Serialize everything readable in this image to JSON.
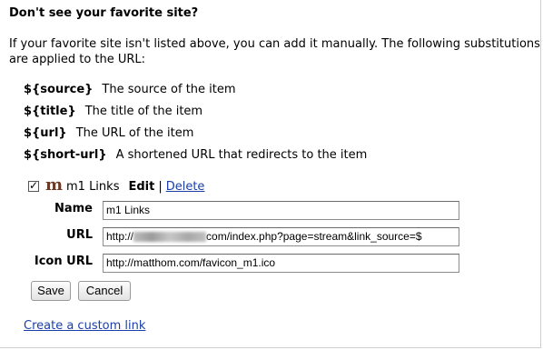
{
  "heading": "Don't see your favorite site?",
  "intro": "If your favorite site isn't listed above, you can add it manually. The following substitutions are applied to the URL:",
  "substitutions": [
    {
      "key": "${source}",
      "desc": "The source of the item"
    },
    {
      "key": "${title}",
      "desc": "The title of the item"
    },
    {
      "key": "${url}",
      "desc": "The URL of the item"
    },
    {
      "key": "${short-url}",
      "desc": "A shortened URL that redirects to the item"
    }
  ],
  "item": {
    "checked": true,
    "checkbox_glyph": "✓",
    "favicon_glyph": "m",
    "name": "m1 Links",
    "edit_label": "Edit",
    "separator": "|",
    "delete_label": "Delete"
  },
  "form": {
    "name_label": "Name",
    "name_value": "m1 Links",
    "url_label": "URL",
    "url_prefix": "http://",
    "url_suffix": "com/index.php?page=stream&link_source=$",
    "icon_label": "Icon URL",
    "icon_value": "http://matthom.com/favicon_m1.ico"
  },
  "buttons": {
    "save": "Save",
    "cancel": "Cancel"
  },
  "custom_link": "Create a custom link",
  "colors": {
    "link": "#1a3fa8",
    "favicon": "#6b3a25"
  }
}
